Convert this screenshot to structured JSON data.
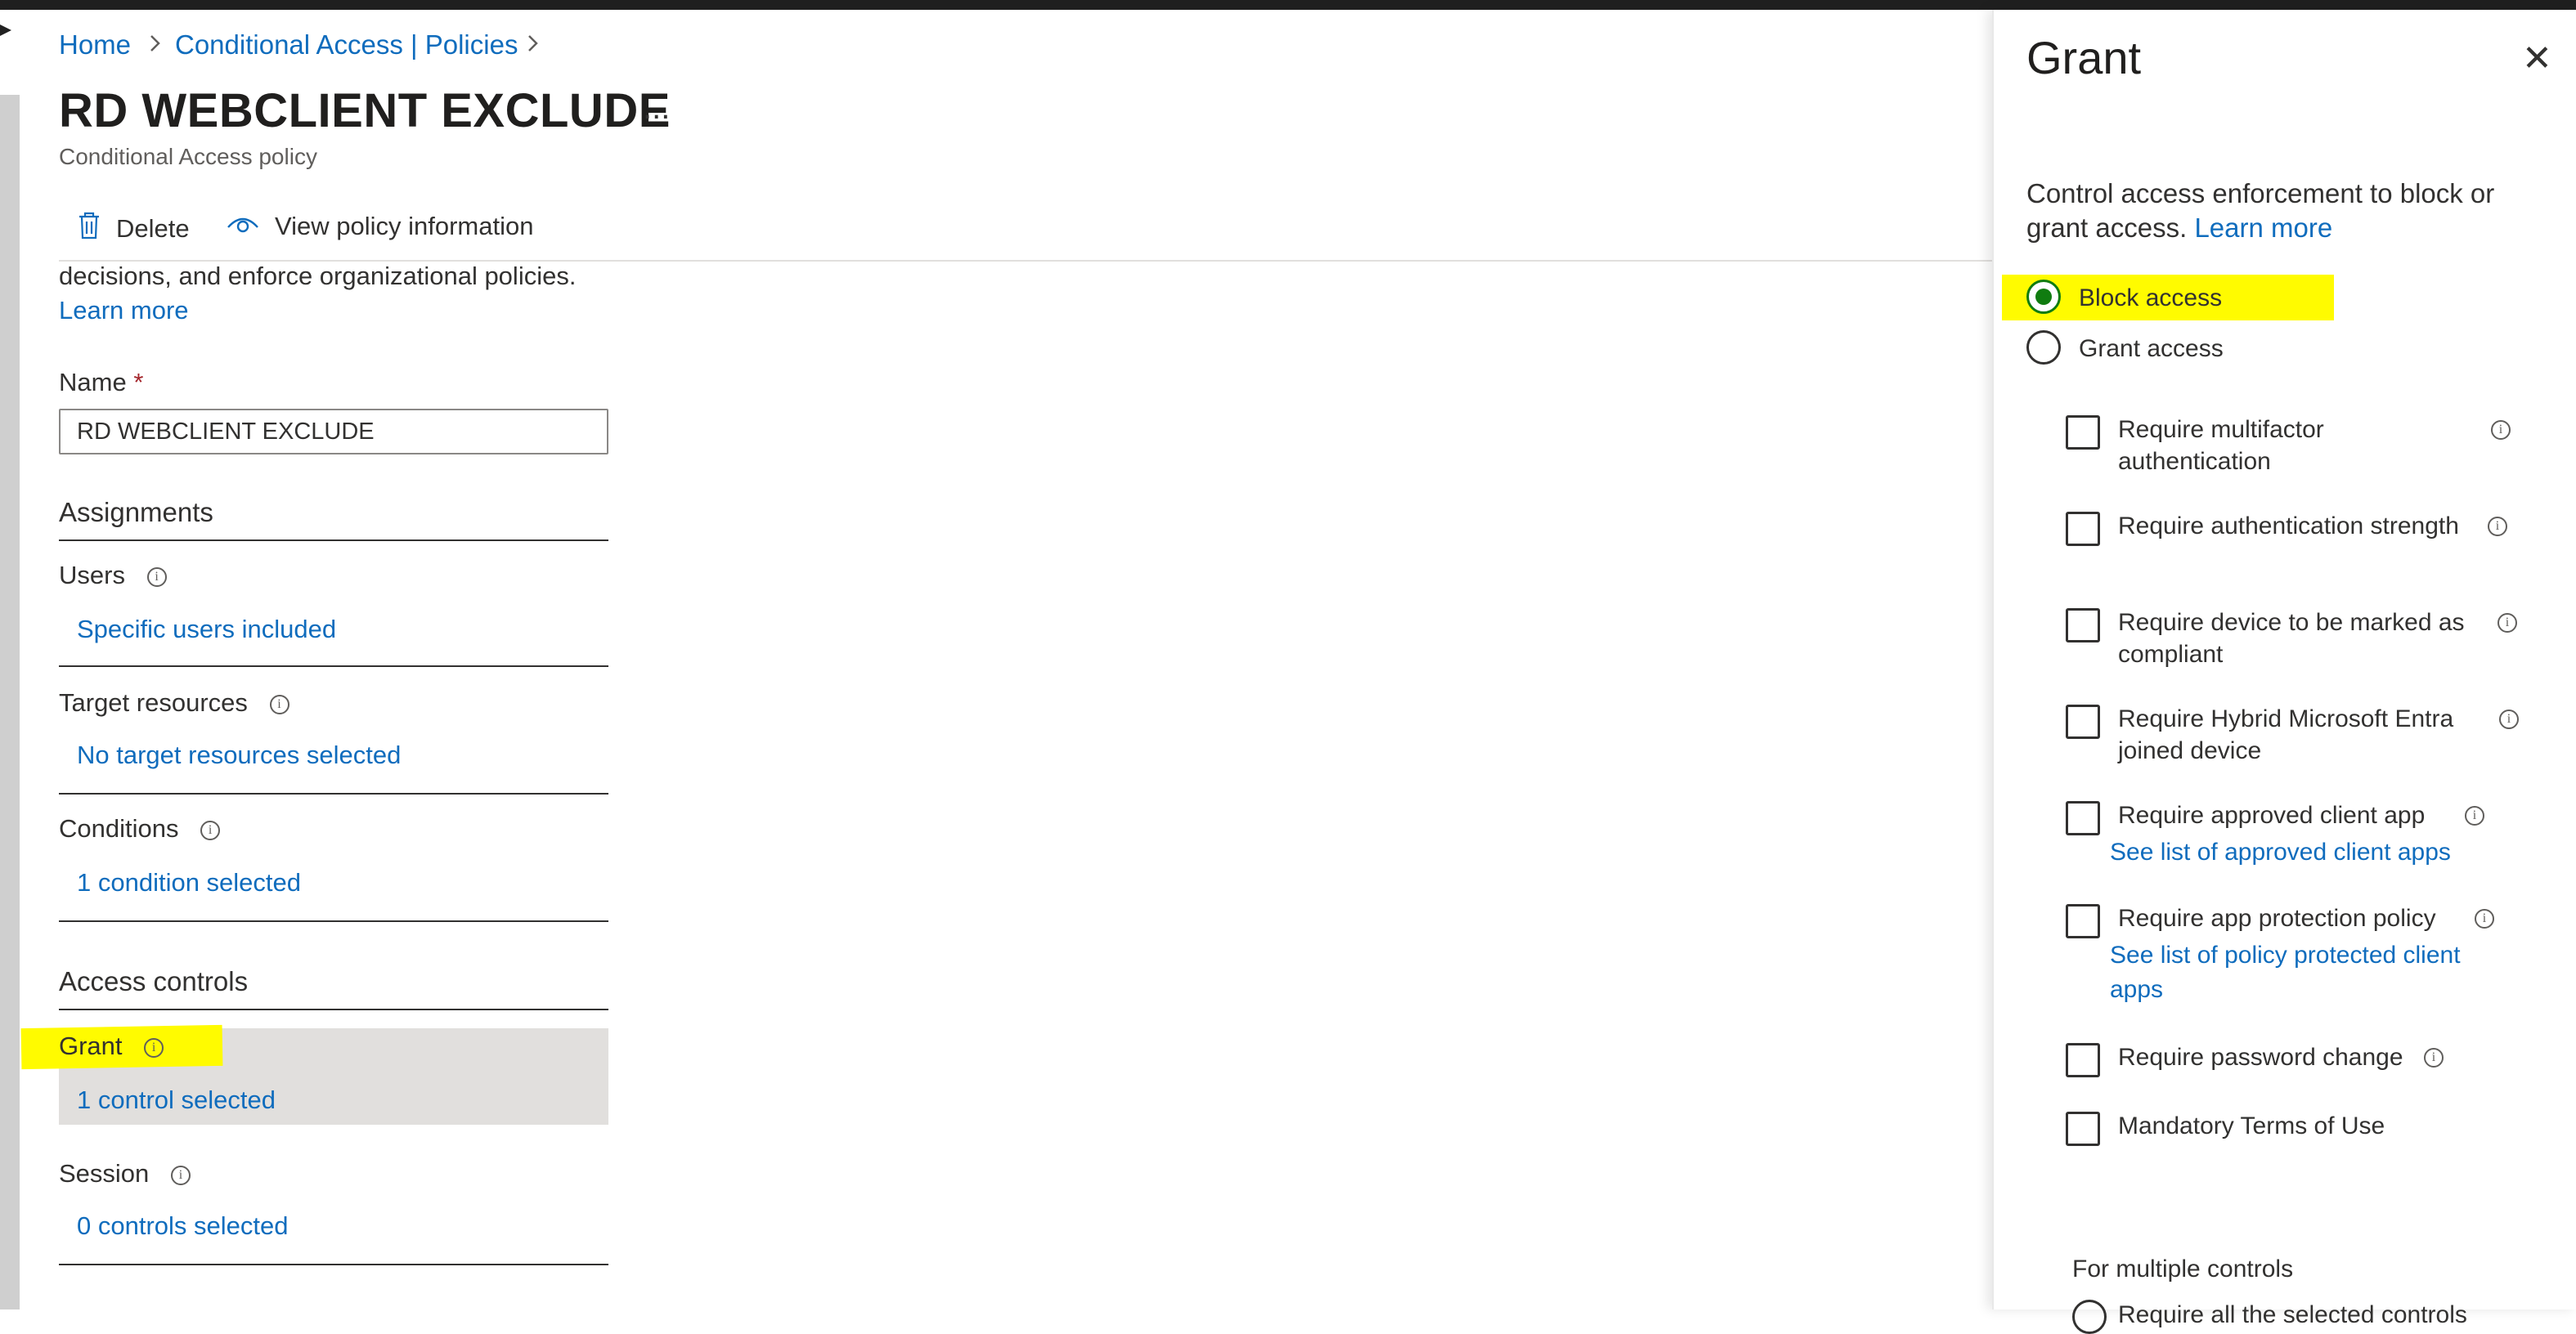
{
  "breadcrumb": {
    "home": "Home",
    "policies": "Conditional Access | Policies",
    "sep": ">"
  },
  "page": {
    "title": "RD WEBCLIENT EXCLUDE",
    "more": "...",
    "subtitle": "Conditional Access policy"
  },
  "toolbar": {
    "delete": "Delete",
    "view_info": "View policy information"
  },
  "description": {
    "text": "decisions, and enforce organizational policies.",
    "learn_more": "Learn more"
  },
  "name_field": {
    "label": "Name",
    "required": "*",
    "value": "RD WEBCLIENT EXCLUDE"
  },
  "assignments": {
    "heading": "Assignments",
    "users": {
      "label": "Users",
      "value": "Specific users included"
    },
    "target": {
      "label": "Target resources",
      "value": "No target resources selected"
    },
    "conditions": {
      "label": "Conditions",
      "value": "1 condition selected"
    }
  },
  "access_controls": {
    "heading": "Access controls",
    "grant": {
      "label": "Grant",
      "value": "1 control selected"
    },
    "session": {
      "label": "Session",
      "value": "0 controls selected"
    }
  },
  "panel": {
    "title": "Grant",
    "close": "✕",
    "description": "Control access enforcement to block or grant access.",
    "learn_more": "Learn more",
    "radios": {
      "block": "Block access",
      "grant": "Grant access",
      "selected": "Block access"
    },
    "checkboxes": [
      {
        "label": "Require multifactor authentication"
      },
      {
        "label": "Require authentication strength"
      },
      {
        "label": "Require device to be marked as compliant"
      },
      {
        "label": "Require Hybrid Microsoft Entra joined device"
      },
      {
        "label": "Require approved client app",
        "link": "See list of approved client apps"
      },
      {
        "label": "Require app protection policy",
        "link": "See list of policy protected client apps"
      },
      {
        "label": "Require password change"
      },
      {
        "label": "Mandatory Terms of Use"
      }
    ],
    "multiple_controls": {
      "label": "For multiple controls",
      "first_option": "Require all the selected controls"
    }
  },
  "colors": {
    "link": "#0f6cbd",
    "highlight": "#fffb00",
    "radio_selected": "#107c10",
    "grant_row_bg": "#e1dfdd"
  },
  "icons": {
    "delete": "trash-icon",
    "view": "eye-icon",
    "info": "info-icon",
    "close": "close-icon",
    "chevron": "chevron-right-icon"
  }
}
